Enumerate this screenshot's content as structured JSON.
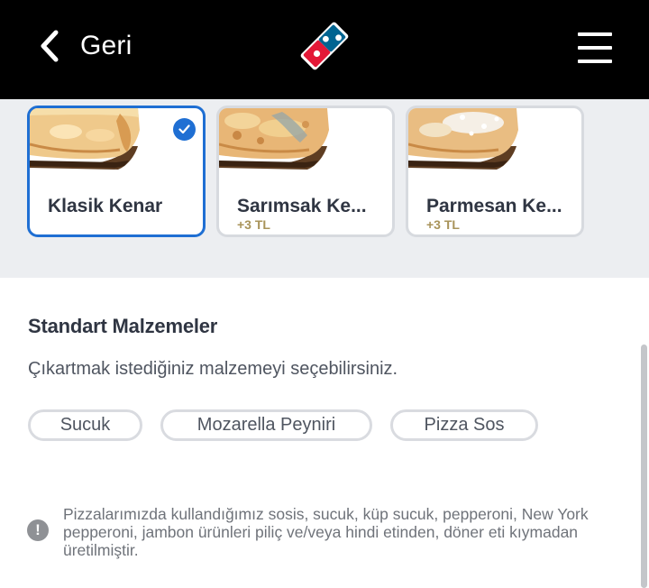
{
  "header": {
    "back_label": "Geri",
    "back_icon": "chevron-left-icon",
    "logo": "dominos-logo",
    "menu_icon": "hamburger-menu-icon",
    "background": "#000000"
  },
  "crust_options": [
    {
      "title": "Klasik Kenar",
      "price": "",
      "selected": true
    },
    {
      "title": "Sarımsak Ke...",
      "price": "+3 TL",
      "selected": false
    },
    {
      "title": "Parmesan Ke...",
      "price": "+3 TL",
      "selected": false
    }
  ],
  "standard_ingredients": {
    "title": "Standart Malzemeler",
    "subtitle": "Çıkartmak istediğiniz malzemeyi seçebilirsiniz.",
    "items": [
      "Sucuk",
      "Mozarella Peyniri",
      "Pizza Sos"
    ]
  },
  "note": {
    "icon": "exclamation-circle-icon",
    "text": "Pizzalarımızda kullandığımız sosis, sucuk, küp sucuk, pepperoni, New York pepperoni, jambon ürünleri piliç ve/veya hindi etinden, döner eti kıymadan üretilmiştir."
  },
  "colors": {
    "accent": "#1f6fd3",
    "price": "#a8935a",
    "section_bg": "#eceef1",
    "text": "#2f3542"
  }
}
